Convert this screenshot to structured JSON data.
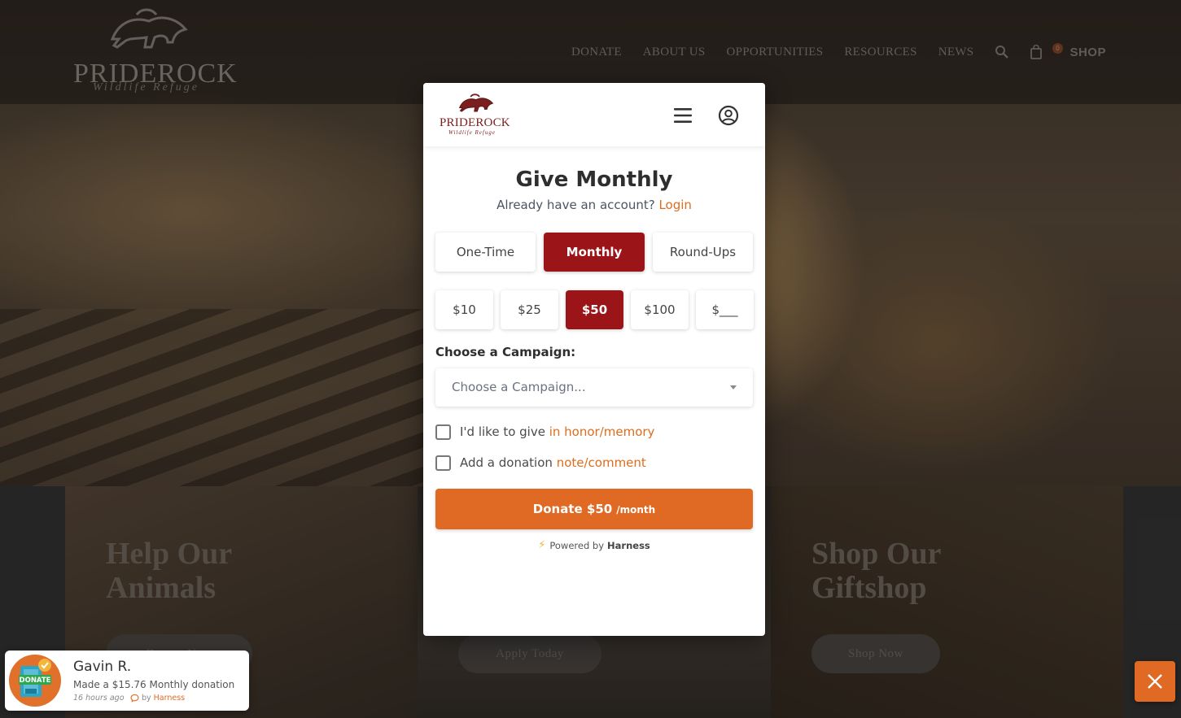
{
  "site": {
    "logo": {
      "name": "PRIDEROCK",
      "tagline": "Wildlife Refuge"
    },
    "nav": {
      "items": [
        "DONATE",
        "ABOUT US",
        "OPPORTUNITIES",
        "RESOURCES",
        "NEWS"
      ],
      "cart_count": "0",
      "shop_label": "SHOP"
    },
    "cards": [
      {
        "title_line1": "Help Our",
        "title_line2": "Animals",
        "button": "Donate Now"
      },
      {
        "title_line1": "",
        "title_line2": "",
        "button": "Apply Today"
      },
      {
        "title_line1": "Shop Our",
        "title_line2": "Giftshop",
        "button": "Shop Now"
      }
    ]
  },
  "modal": {
    "logo": {
      "name": "PRIDEROCK",
      "tagline": "Wildlife Refuge"
    },
    "title": "Give Monthly",
    "subtitle_prefix": "Already have an account?",
    "login_link": "Login",
    "frequency_options": [
      {
        "label": "One-Time",
        "selected": false
      },
      {
        "label": "Monthly",
        "selected": true
      },
      {
        "label": "Round-Ups",
        "selected": false
      }
    ],
    "amounts": [
      {
        "label": "$10",
        "selected": false
      },
      {
        "label": "$25",
        "selected": false
      },
      {
        "label": "$50",
        "selected": true
      },
      {
        "label": "$100",
        "selected": false
      },
      {
        "label": "$___",
        "selected": false
      }
    ],
    "campaign_label": "Choose a Campaign:",
    "campaign_placeholder": "Choose a Campaign...",
    "honor_text": "I'd like to give",
    "honor_link": "in honor/memory",
    "note_text": "Add a donation",
    "note_link": "note/comment",
    "donate_button": "Donate $50",
    "donate_unit": "/month",
    "powered_by": "Powered by",
    "powered_brand": "Harness"
  },
  "toast": {
    "name": "Gavin R.",
    "message": "Made a $15.76 Monthly donation",
    "time": "16 hours ago",
    "by_label": "by",
    "by_brand": "Harness",
    "avatar_label": "DONATE"
  },
  "colors": {
    "primary_red": "#9b1518",
    "accent_orange": "#e06a23",
    "link_orange": "#e06d1d"
  },
  "icons": {
    "menu": "hamburger-menu-icon",
    "account": "user-circle-icon",
    "search": "search-icon",
    "cart": "shopping-bag-icon",
    "close": "close-icon",
    "bolt": "lightning-bolt-icon",
    "chat": "chat-bubble-icon"
  }
}
